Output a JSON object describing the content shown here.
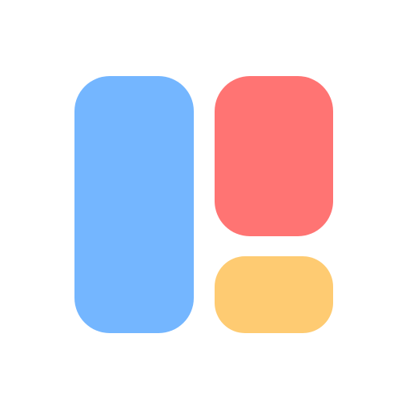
{
  "icon": {
    "name": "layout-widgets-icon",
    "colors": {
      "background": "#ffffff",
      "left_panel": "#74b6ff",
      "top_right_panel": "#ff7473",
      "bottom_right_panel": "#fecb72"
    }
  }
}
